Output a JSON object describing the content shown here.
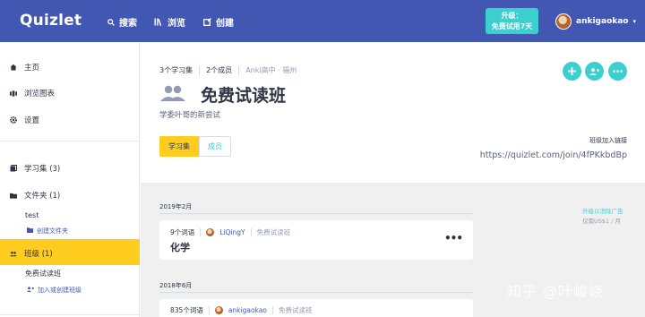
{
  "topbar": {
    "logo": "Quizlet",
    "search_label": "搜索",
    "browse_label": "浏览",
    "create_label": "创建",
    "upgrade_line1": "升级：",
    "upgrade_line2": "免费试用7天",
    "username": "ankigaokao",
    "caret": "▾"
  },
  "sidebar": {
    "home": "主页",
    "browse_charts": "浏览图表",
    "settings": "设置",
    "study_sets": "学习集 (3)",
    "folders": "文件夹 (1)",
    "folder_name": "test",
    "create_folder": "创建文件夹",
    "classes": "班级 (1)",
    "class_name": "免费试读班",
    "join_class": "加入或创建班级"
  },
  "class": {
    "sets_count": "3个学习集",
    "members_count": "2个成员",
    "school": "Anki高中 · 福州",
    "name": "免费试读班",
    "description": "学委叶哥的新尝试",
    "tab_sets": "学习集",
    "tab_members": "成员",
    "join_label": "班级加入链接",
    "join_url": "https://quizlet.com/join/4fPKkbdBp"
  },
  "feed": {
    "groups": [
      {
        "month": "2019年2月",
        "terms": "9个词语",
        "user": "LiQingY",
        "class": "免费试读班",
        "title": "化学"
      },
      {
        "month": "2018年6月",
        "terms": "835个词语",
        "user": "ankigaokao",
        "class": "免费试读班",
        "title": ""
      }
    ],
    "ad_link": "升级以消除广告",
    "ad_price": "仅需US$1 / 月"
  },
  "watermark": "知乎 @叶峻峣",
  "colors": {
    "brand": "#4257b2",
    "accent": "#3ccfcf",
    "highlight": "#ffcd1f"
  }
}
